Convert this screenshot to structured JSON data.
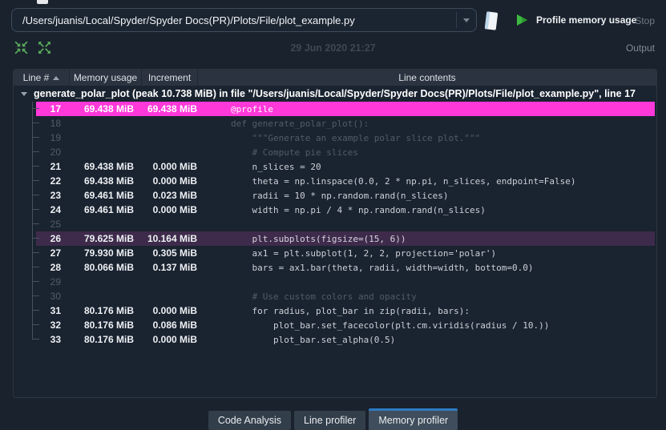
{
  "toolbar": {
    "path_value": "/Users/juanis/Local/Spyder/Spyder Docs(PR)/Plots/File/plot_example.py",
    "profile_label": "Profile memory usage",
    "stop_label": "Stop",
    "date_label": "29 Jun 2020 21:27",
    "output_label": "Output",
    "icons": [
      "chevron-down-icon",
      "notebook-icon",
      "play-icon",
      "collapse-all-icon",
      "expand-all-icon"
    ]
  },
  "colors": {
    "highlight_magenta": "#ff38d9",
    "highlight_purple": "#3e2b4b",
    "accent_blue": "#2e7bc4",
    "icon_green": "#5aab5c"
  },
  "table": {
    "columns": [
      "Line #",
      "Memory usage",
      "Increment",
      "Line contents"
    ],
    "sort_column": "Line #",
    "sort_order": "ascending",
    "root_label": "generate_polar_plot (peak 10.738 MiB) in file \"/Users/juanis/Local/Spyder/Spyder Docs(PR)/Plots/File/plot_example.py\", line 17",
    "rows": [
      {
        "line": "17",
        "memory": "69.438 MiB",
        "increment": "69.438 MiB",
        "code": "@profile",
        "highlight": "magenta",
        "dim": false
      },
      {
        "line": "18",
        "memory": "",
        "increment": "",
        "code": "def generate_polar_plot():",
        "highlight": "",
        "dim": true
      },
      {
        "line": "19",
        "memory": "",
        "increment": "",
        "code": "    \"\"\"Generate an example polar slice plot.\"\"\"",
        "highlight": "",
        "dim": true
      },
      {
        "line": "20",
        "memory": "",
        "increment": "",
        "code": "    # Compute pie slices",
        "highlight": "",
        "dim": true
      },
      {
        "line": "21",
        "memory": "69.438 MiB",
        "increment": "0.000 MiB",
        "code": "    n_slices = 20",
        "highlight": "",
        "dim": false
      },
      {
        "line": "22",
        "memory": "69.438 MiB",
        "increment": "0.000 MiB",
        "code": "    theta = np.linspace(0.0, 2 * np.pi, n_slices, endpoint=False)",
        "highlight": "",
        "dim": false
      },
      {
        "line": "23",
        "memory": "69.461 MiB",
        "increment": "0.023 MiB",
        "code": "    radii = 10 * np.random.rand(n_slices)",
        "highlight": "",
        "dim": false
      },
      {
        "line": "24",
        "memory": "69.461 MiB",
        "increment": "0.000 MiB",
        "code": "    width = np.pi / 4 * np.random.rand(n_slices)",
        "highlight": "",
        "dim": false
      },
      {
        "line": "25",
        "memory": "",
        "increment": "",
        "code": "",
        "highlight": "",
        "dim": true
      },
      {
        "line": "26",
        "memory": "79.625 MiB",
        "increment": "10.164 MiB",
        "code": "    plt.subplots(figsize=(15, 6))",
        "highlight": "purple",
        "dim": false
      },
      {
        "line": "27",
        "memory": "79.930 MiB",
        "increment": "0.305 MiB",
        "code": "    ax1 = plt.subplot(1, 2, 2, projection='polar')",
        "highlight": "",
        "dim": false
      },
      {
        "line": "28",
        "memory": "80.066 MiB",
        "increment": "0.137 MiB",
        "code": "    bars = ax1.bar(theta, radii, width=width, bottom=0.0)",
        "highlight": "",
        "dim": false
      },
      {
        "line": "29",
        "memory": "",
        "increment": "",
        "code": "",
        "highlight": "",
        "dim": true
      },
      {
        "line": "30",
        "memory": "",
        "increment": "",
        "code": "    # Use custom colors and opacity",
        "highlight": "",
        "dim": true
      },
      {
        "line": "31",
        "memory": "80.176 MiB",
        "increment": "0.000 MiB",
        "code": "    for radius, plot_bar in zip(radii, bars):",
        "highlight": "",
        "dim": false
      },
      {
        "line": "32",
        "memory": "80.176 MiB",
        "increment": "0.086 MiB",
        "code": "        plot_bar.set_facecolor(plt.cm.viridis(radius / 10.))",
        "highlight": "",
        "dim": false
      },
      {
        "line": "33",
        "memory": "80.176 MiB",
        "increment": "0.000 MiB",
        "code": "        plot_bar.set_alpha(0.5)",
        "highlight": "",
        "dim": false
      }
    ]
  },
  "tabs": [
    {
      "label": "Code Analysis",
      "active": false
    },
    {
      "label": "Line profiler",
      "active": false
    },
    {
      "label": "Memory profiler",
      "active": true
    }
  ]
}
